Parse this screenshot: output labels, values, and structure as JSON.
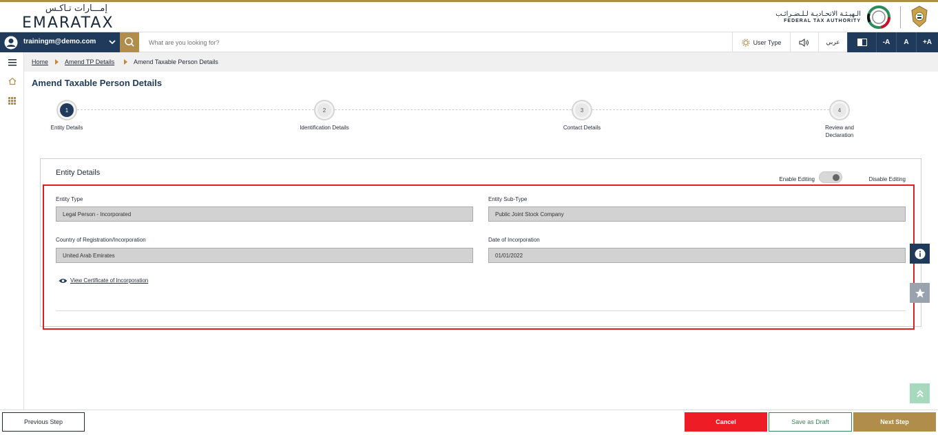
{
  "brand": {
    "logo_ar": "إمـــارات تـاكـس",
    "logo_en": "EMARATAX",
    "authority_ar": "الـهيـئـة الاتحـاديـة لـلـضـرائـب",
    "authority_en": "FEDERAL TAX AUTHORITY"
  },
  "toolbar": {
    "user_email": "trainingm@demo.com",
    "search_placeholder": "What are you looking for?",
    "user_type_label": "User Type",
    "language_label": "عربي",
    "font_decrease": "-A",
    "font_normal": "A",
    "font_increase": "+A"
  },
  "breadcrumb": {
    "home": "Home",
    "amend_tp": "Amend TP Details",
    "current": "Amend Taxable Person Details"
  },
  "page": {
    "title": "Amend Taxable Person Details"
  },
  "stepper": {
    "steps": [
      {
        "number": "1",
        "label": "Entity Details"
      },
      {
        "number": "2",
        "label": "Identification Details"
      },
      {
        "number": "3",
        "label": "Contact Details"
      },
      {
        "number": "4",
        "label": "Review and Declaration"
      }
    ],
    "active_step": 1
  },
  "entity_details": {
    "title": "Entity Details",
    "enable_editing": "Enable Editing",
    "disable_editing": "Disable Editing",
    "entity_type_label": "Entity Type",
    "entity_type_value": "Legal Person - Incorporated",
    "entity_subtype_label": "Entity Sub-Type",
    "entity_subtype_value": "Public Joint Stock Company",
    "country_label": "Country of Registration/Incorporation",
    "country_value": "United Arab Emirates",
    "date_label": "Date of Incorporation",
    "date_value": "01/01/2022",
    "certificate_link": "View Certificate of Incorporation"
  },
  "footer": {
    "previous_step": "Previous Step",
    "cancel": "Cancel",
    "save_draft": "Save as Draft",
    "next_step": "Next Step"
  },
  "colors": {
    "navy": "#1f3a5a",
    "gold": "#b08d4a",
    "cancel_red": "#ee1c25",
    "draft_green": "#2e8b57",
    "highlight_red": "#e01e1e"
  }
}
